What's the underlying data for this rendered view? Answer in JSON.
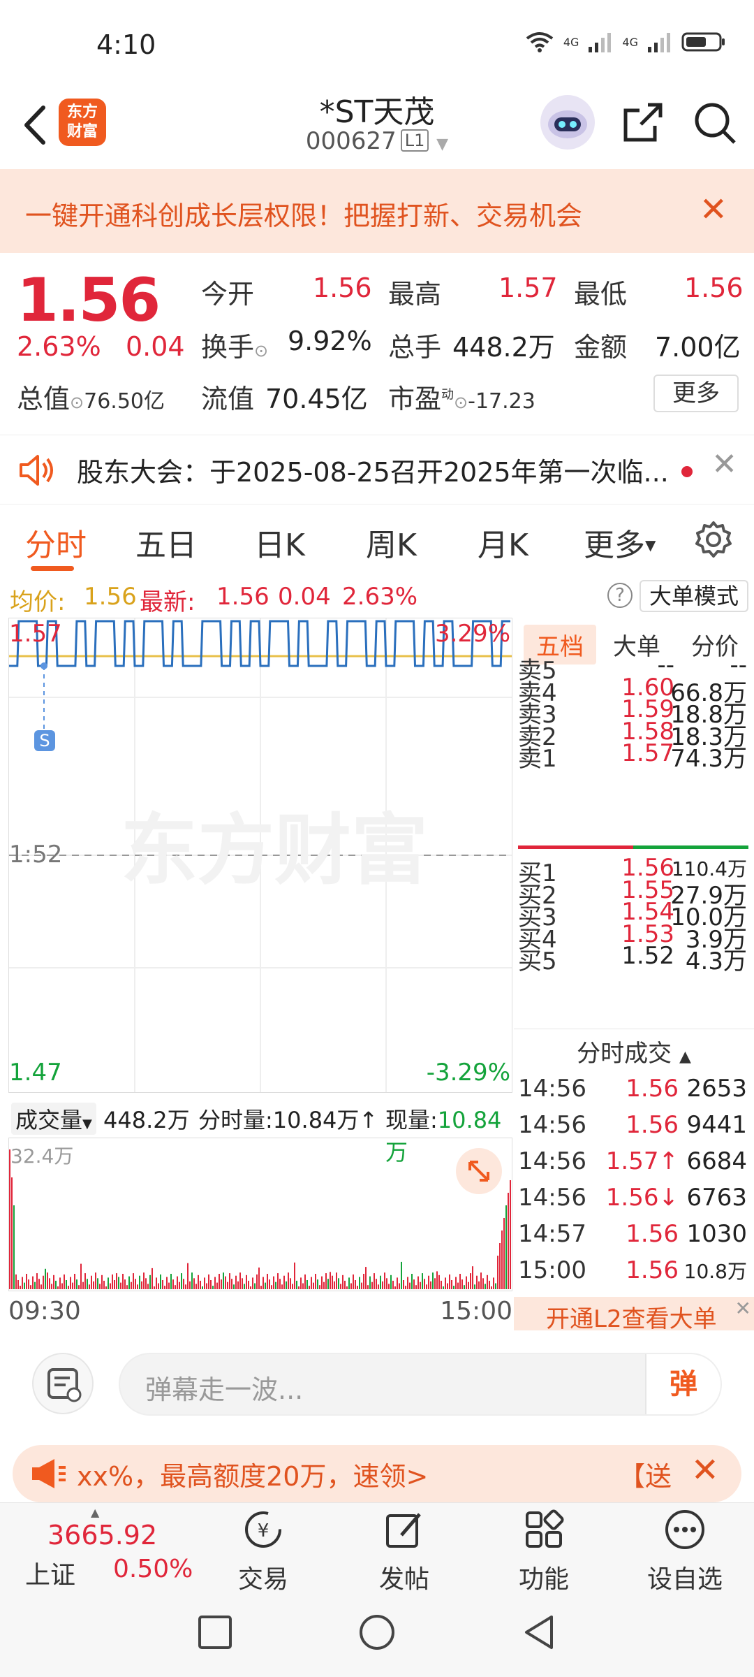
{
  "status": {
    "time": "4:10",
    "network": [
      "4G",
      "4G"
    ]
  },
  "header": {
    "logo_text": "东方财富",
    "title": "*ST天茂",
    "code": "000627",
    "level": "L1"
  },
  "promo": {
    "text": "一键开通科创成长层权限！把握打新、交易机会"
  },
  "quote": {
    "price": "1.56",
    "change_pct": "2.63%",
    "change": "0.04",
    "open_label": "今开",
    "open": "1.56",
    "high_label": "最高",
    "high": "1.57",
    "low_label": "最低",
    "low": "1.56",
    "turnover_label": "换手",
    "turnover": "9.92%",
    "volume_label": "总手",
    "volume": "448.2万",
    "amount_label": "金额",
    "amount": "7.00亿",
    "mktcap_label": "总值",
    "mktcap": "76.50亿",
    "float_label": "流值",
    "float_cap": "70.45亿",
    "pe_label": "市盈",
    "pe_sup": "动",
    "pe": "-17.23",
    "more": "更多"
  },
  "notice": {
    "text": "股东大会：于2025-08-25召开2025年第一次临..."
  },
  "tabs": [
    "分时",
    "五日",
    "日K",
    "周K",
    "月K",
    "更多"
  ],
  "avg_row": {
    "avg_label": "均价:",
    "avg": "1.56",
    "latest_label": "最新:",
    "latest": "1.56",
    "chg": "0.04",
    "pct": "2.63%",
    "mode": "大单模式"
  },
  "chart": {
    "y_top": "1.57",
    "y_mid": "1:52",
    "y_bot": "1.47",
    "pct_top": "3.29%",
    "pct_bot": "-3.29%",
    "marker": "S",
    "watermark": "东方财富"
  },
  "volume": {
    "selector": "成交量",
    "total": "448.2万",
    "min_label": "分时量:",
    "min_val": "10.84万",
    "now_label": "现量:",
    "now_val": "10.84万",
    "max": "32.4万"
  },
  "times": {
    "start": "09:30",
    "end": "15:00"
  },
  "book": {
    "tabs": [
      "五档",
      "大单",
      "分价"
    ],
    "asks": [
      {
        "label": "卖5",
        "price": "--",
        "vol": "--"
      },
      {
        "label": "卖4",
        "price": "1.60",
        "vol": "66.8万"
      },
      {
        "label": "卖3",
        "price": "1.59",
        "vol": "18.8万"
      },
      {
        "label": "卖2",
        "price": "1.58",
        "vol": "18.3万"
      },
      {
        "label": "卖1",
        "price": "1.57",
        "vol": "74.3万"
      }
    ],
    "bids": [
      {
        "label": "买1",
        "price": "1.56",
        "vol": "110.4万"
      },
      {
        "label": "买2",
        "price": "1.55",
        "vol": "27.9万"
      },
      {
        "label": "买3",
        "price": "1.54",
        "vol": "10.0万"
      },
      {
        "label": "买4",
        "price": "1.53",
        "vol": "3.9万"
      },
      {
        "label": "买5",
        "price": "1.52",
        "vol": "4.3万"
      }
    ],
    "ticks_title": "分时成交",
    "ticks": [
      {
        "time": "14:56",
        "price": "1.56",
        "arrow": "",
        "vol": "2653"
      },
      {
        "time": "14:56",
        "price": "1.56",
        "arrow": "",
        "vol": "9441"
      },
      {
        "time": "14:56",
        "price": "1.57",
        "arrow": "↑",
        "vol": "6684"
      },
      {
        "time": "14:56",
        "price": "1.56",
        "arrow": "↓",
        "vol": "6763"
      },
      {
        "time": "14:57",
        "price": "1.56",
        "arrow": "",
        "vol": "1030"
      },
      {
        "time": "15:00",
        "price": "1.56",
        "arrow": "",
        "vol": "10.8万"
      }
    ],
    "l2": "开通L2查看大单"
  },
  "danmu": {
    "placeholder": "弹幕走一波...",
    "send": "弹"
  },
  "ad": {
    "text": "xx%，最高额度20万，速领>",
    "gift": "【送"
  },
  "bottom": {
    "index_value": "3665.92",
    "index_name": "上证",
    "index_pct": "0.50%",
    "items": [
      "交易",
      "发帖",
      "功能",
      "设自选"
    ]
  }
}
